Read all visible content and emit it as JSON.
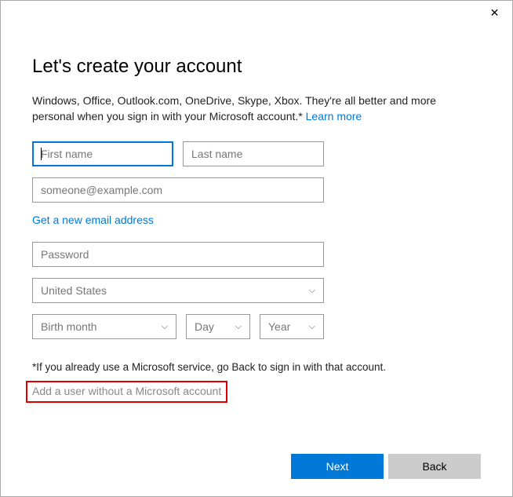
{
  "title": "Let's create your account",
  "description_prefix": "Windows, Office, Outlook.com, OneDrive, Skype, Xbox. They're all better and more personal when you sign in with your Microsoft account.* ",
  "learn_more": "Learn more",
  "fields": {
    "first_name_placeholder": "First name",
    "last_name_placeholder": "Last name",
    "email_placeholder": "someone@example.com",
    "new_email_link": "Get a new email address",
    "password_placeholder": "Password",
    "country_value": "United States",
    "birth_month_placeholder": "Birth month",
    "day_placeholder": "Day",
    "year_placeholder": "Year"
  },
  "footnote": "*If you already use a Microsoft service, go Back to sign in with that account.",
  "alt_link": "Add a user without a Microsoft account",
  "buttons": {
    "next": "Next",
    "back": "Back"
  },
  "close_glyph": "✕"
}
